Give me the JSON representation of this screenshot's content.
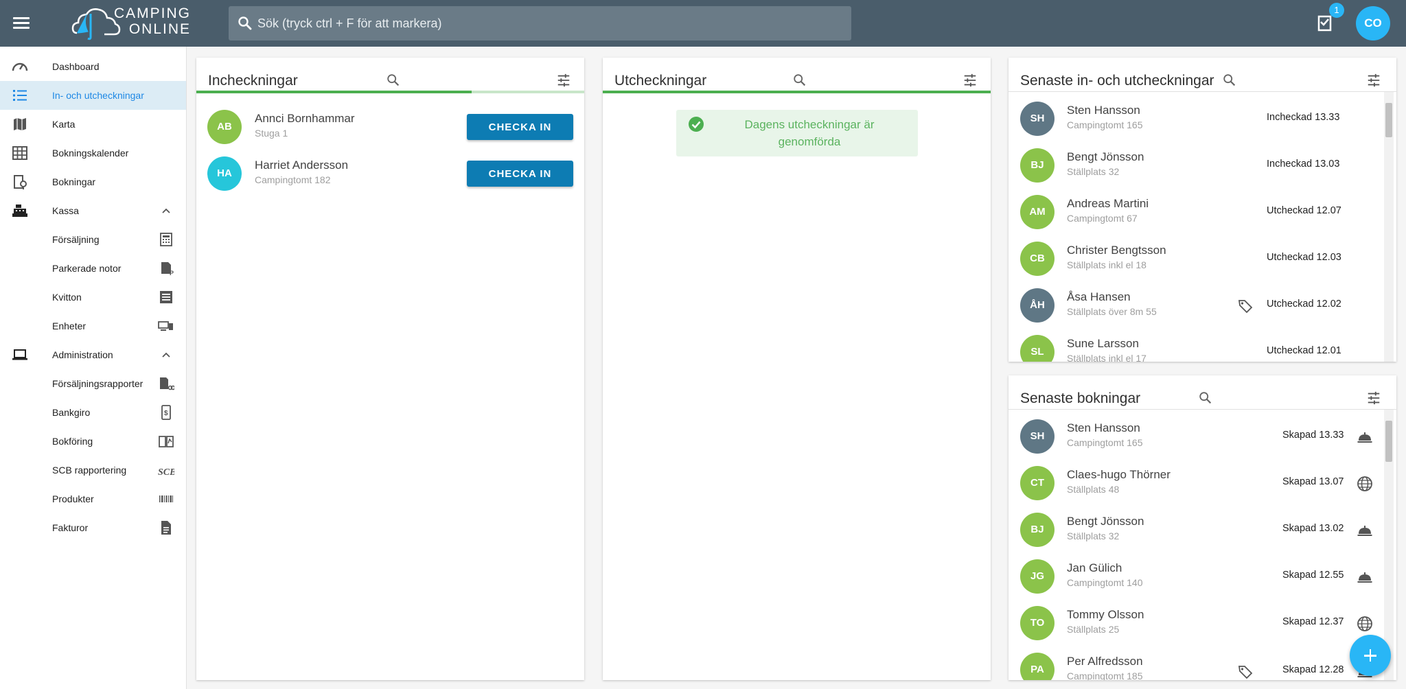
{
  "topbar": {
    "logo_line1": "CAMPING",
    "logo_line2": "ONLINE",
    "search_placeholder": "Sök (tryck ctrl + F för att markera)",
    "notification_count": "1",
    "user_initials": "CO"
  },
  "sidebar": {
    "items": [
      {
        "label": "Dashboard",
        "icon": "speedometer-icon"
      },
      {
        "label": "In- och utcheckningar",
        "icon": "list-icon",
        "active": true
      },
      {
        "label": "Karta",
        "icon": "map-icon"
      },
      {
        "label": "Bokningskalender",
        "icon": "calendar-grid-icon"
      },
      {
        "label": "Bokningar",
        "icon": "booking-icon"
      },
      {
        "label": "Kassa",
        "icon": "cash-register-icon"
      },
      {
        "label": "Försäljning",
        "icon": "calculator-icon"
      },
      {
        "label": "Parkerade notor",
        "icon": "parked-note-icon"
      },
      {
        "label": "Kvitton",
        "icon": "receipt-icon"
      },
      {
        "label": "Enheter",
        "icon": "devices-icon"
      },
      {
        "label": "Administration",
        "icon": "laptop-icon"
      },
      {
        "label": "Försäljningsrapporter",
        "icon": "report-icon"
      },
      {
        "label": "Bankgiro",
        "icon": "bankgiro-icon"
      },
      {
        "label": "Bokföring",
        "icon": "book-icon"
      },
      {
        "label": "SCB rapportering",
        "icon": "scb-icon"
      },
      {
        "label": "Produkter",
        "icon": "barcode-icon"
      },
      {
        "label": "Fakturor",
        "icon": "document-icon"
      }
    ]
  },
  "checkins": {
    "title": "Incheckningar",
    "button_label": "CHECKA IN",
    "items": [
      {
        "initials": "AB",
        "name": "Annci Bornhammar",
        "place": "Stuga 1"
      },
      {
        "initials": "HA",
        "name": "Harriet Andersson",
        "place": "Campingtomt 182"
      }
    ]
  },
  "checkouts": {
    "title": "Utcheckningar",
    "message": "Dagens utcheckningar är genomförda"
  },
  "recent_checks": {
    "title": "Senaste in- och utcheckningar",
    "items": [
      {
        "initials": "SH",
        "name": "Sten Hansson",
        "place": "Campingtomt 165",
        "status": "Incheckad 13.33"
      },
      {
        "initials": "BJ",
        "name": "Bengt Jönsson",
        "place": "Ställplats 32",
        "status": "Incheckad 13.03"
      },
      {
        "initials": "AM",
        "name": "Andreas Martini",
        "place": "Campingtomt 67",
        "status": "Utcheckad 12.07"
      },
      {
        "initials": "CB",
        "name": "Christer Bengtsson",
        "place": "Ställplats inkl el 18",
        "status": "Utcheckad 12.03"
      },
      {
        "initials": "ÅH",
        "name": "Åsa Hansen",
        "place": "Ställplats över 8m 55",
        "status": "Utcheckad 12.02"
      },
      {
        "initials": "SL",
        "name": "Sune Larsson",
        "place": "Ställplats inkl el 17",
        "status": "Utcheckad 12.01"
      }
    ]
  },
  "recent_bookings": {
    "title": "Senaste bokningar",
    "items": [
      {
        "initials": "SH",
        "name": "Sten Hansson",
        "place": "Campingtomt 165",
        "status": "Skapad 13.33",
        "source_icon": "reception-bell-icon"
      },
      {
        "initials": "CT",
        "name": "Claes-hugo Thörner",
        "place": "Ställplats 48",
        "status": "Skapad 13.07",
        "source_icon": "globe-icon"
      },
      {
        "initials": "BJ",
        "name": "Bengt Jönsson",
        "place": "Ställplats 32",
        "status": "Skapad 13.02",
        "source_icon": "reception-bell-icon"
      },
      {
        "initials": "JG",
        "name": "Jan Gülich",
        "place": "Campingtomt 140",
        "status": "Skapad 12.55",
        "source_icon": "reception-bell-icon"
      },
      {
        "initials": "TO",
        "name": "Tommy Olsson",
        "place": "Ställplats 25",
        "status": "Skapad 12.37",
        "source_icon": "globe-icon"
      },
      {
        "initials": "PA",
        "name": "Per Alfredsson",
        "place": "Campingtomt 185",
        "status": "Skapad 12.28",
        "source_icon": "reception-bell-icon"
      }
    ]
  },
  "colors": {
    "topbar": "#4a5d6b",
    "accent": "#29b6f6",
    "button": "#0d7cb3",
    "avatar_green": "#8bc34a",
    "avatar_slate": "#5f7785",
    "avatar_cyan": "#26c6da",
    "progress_green": "#4caf50",
    "success_text": "#5bb35f"
  }
}
